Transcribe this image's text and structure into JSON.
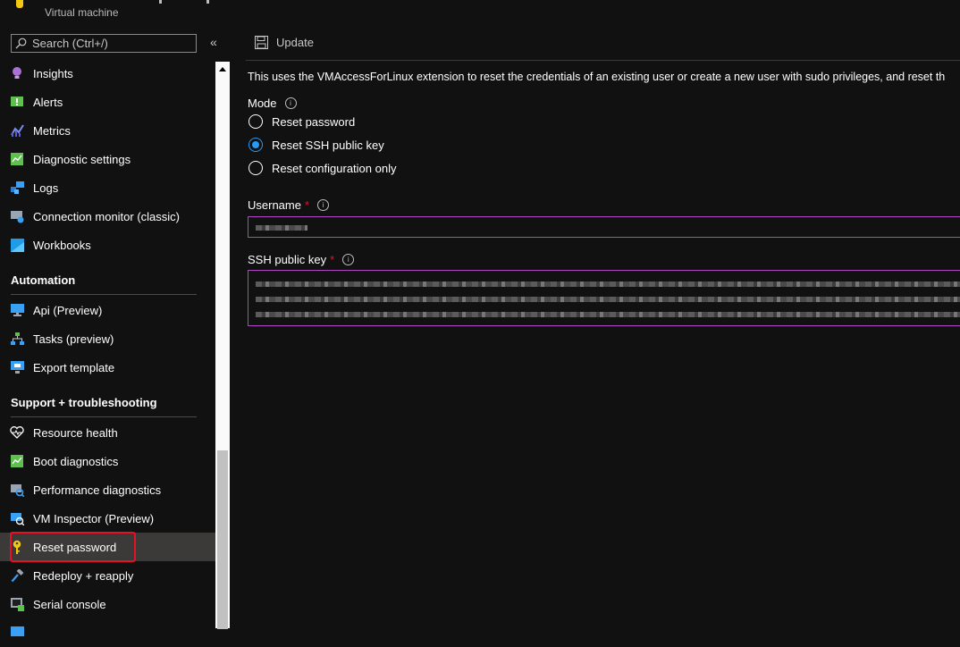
{
  "header": {
    "subtitle": "Virtual machine"
  },
  "sidebar": {
    "search_placeholder": "Search (Ctrl+/)",
    "collapse_glyph": "«",
    "monitoring_items": [
      {
        "label": "Insights",
        "icon": "lightbulb-icon"
      },
      {
        "label": "Alerts",
        "icon": "alert-icon"
      },
      {
        "label": "Metrics",
        "icon": "metrics-chart-icon"
      },
      {
        "label": "Diagnostic settings",
        "icon": "diagnostic-settings-icon"
      },
      {
        "label": "Logs",
        "icon": "logs-icon"
      },
      {
        "label": "Connection monitor (classic)",
        "icon": "connection-monitor-icon"
      },
      {
        "label": "Workbooks",
        "icon": "workbooks-icon"
      }
    ],
    "automation_heading": "Automation",
    "automation_items": [
      {
        "label": "Api (Preview)",
        "icon": "api-icon"
      },
      {
        "label": "Tasks (preview)",
        "icon": "tasks-icon"
      },
      {
        "label": "Export template",
        "icon": "export-template-icon"
      }
    ],
    "support_heading": "Support + troubleshooting",
    "support_items": [
      {
        "label": "Resource health",
        "icon": "heart-pulse-icon"
      },
      {
        "label": "Boot diagnostics",
        "icon": "boot-diagnostics-icon"
      },
      {
        "label": "Performance diagnostics",
        "icon": "performance-diagnostics-icon"
      },
      {
        "label": "VM Inspector (Preview)",
        "icon": "vm-inspector-icon"
      },
      {
        "label": "Reset password",
        "icon": "key-icon",
        "selected": true
      },
      {
        "label": "Redeploy + reapply",
        "icon": "hammer-icon"
      },
      {
        "label": "Serial console",
        "icon": "serial-console-icon"
      }
    ]
  },
  "main": {
    "update_label": "Update",
    "description": "This uses the VMAccessForLinux extension to reset the credentials of an existing user or create a new user with sudo privileges, and reset th",
    "mode_label": "Mode",
    "mode_options": [
      {
        "label": "Reset password",
        "selected": false
      },
      {
        "label": "Reset SSH public key",
        "selected": true
      },
      {
        "label": "Reset configuration only",
        "selected": false
      }
    ],
    "username_label": "Username",
    "ssh_key_label": "SSH public key",
    "required_mark": "*",
    "info_glyph": "i"
  },
  "colors": {
    "background": "#111111",
    "selected_item": "#3b3a39",
    "radio_accent": "#2899f5",
    "field_border": "#b146c2",
    "required": "#e81123",
    "highlight": "#e81123"
  }
}
